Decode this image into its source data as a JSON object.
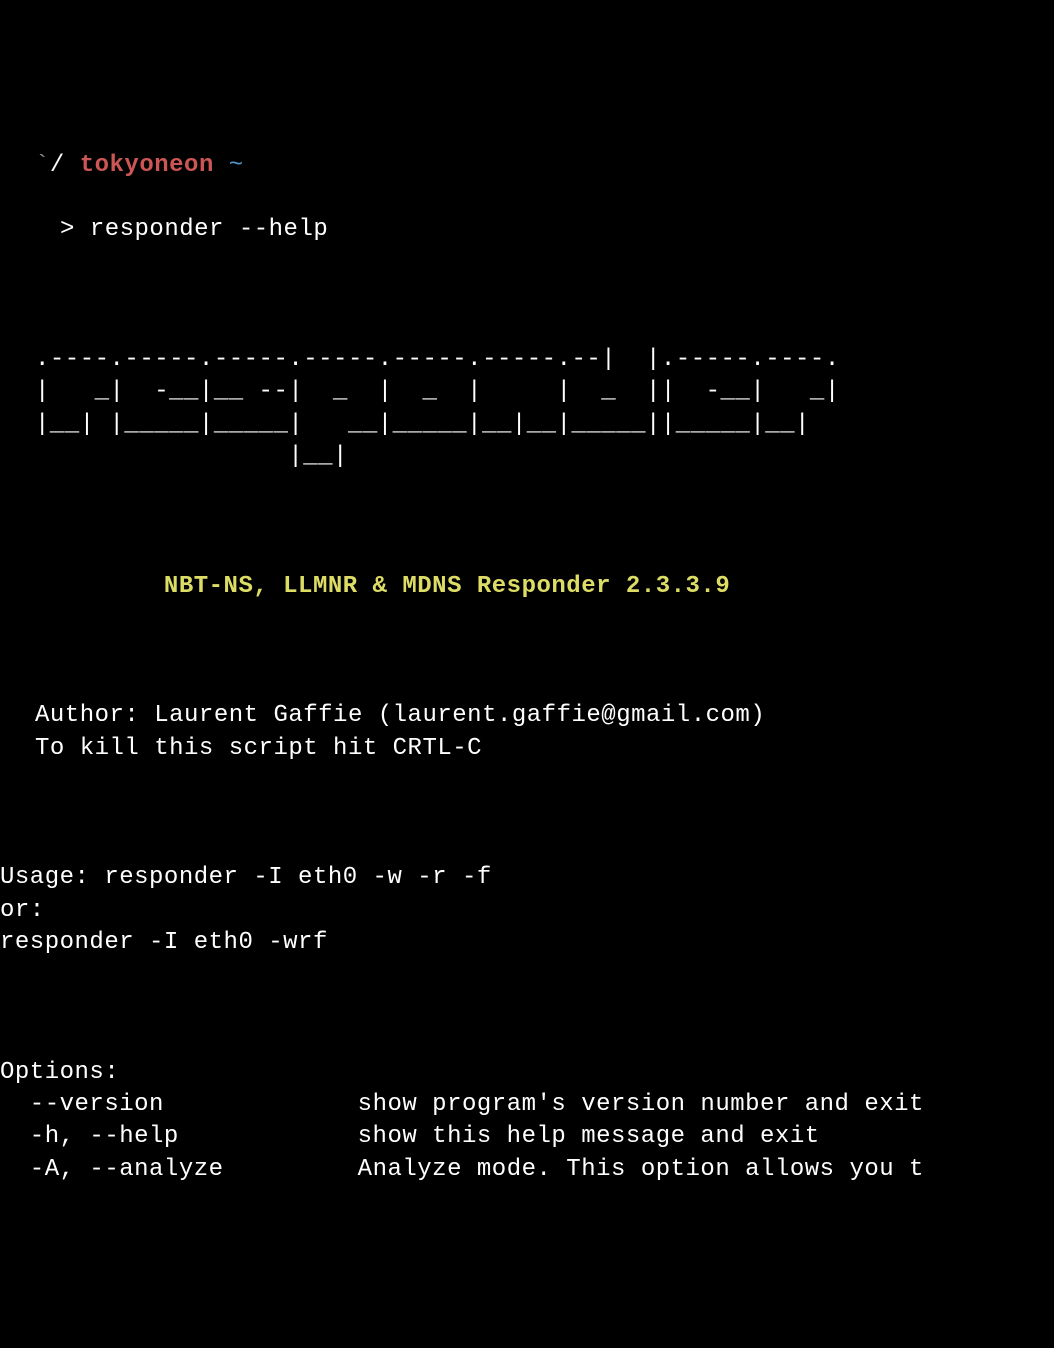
{
  "prompt": {
    "backtick": "`",
    "slash": "/",
    "user": "tokyoneon",
    "tilde": "~",
    "arrow": ">",
    "command": "responder --help"
  },
  "ascii_art": {
    "line1": ".----.-----.-----.-----.-----.-----.--|  |.-----.----.",
    "line2": "|   _|  -__|__ --|  _  |  _  |     |  _  ||  -__|   _|",
    "line3": "|__| |_____|_____|   __|_____|__|__|_____||_____|__|",
    "line4": "                 |__|"
  },
  "title": "           NBT-NS, LLMNR & MDNS Responder 2.3.3.9",
  "author": {
    "line1": "Author: Laurent Gaffie (laurent.gaffie@gmail.com)",
    "line2": "To kill this script hit CRTL-C"
  },
  "usage": {
    "line1": "Usage: responder -I eth0 -w -r -f",
    "line2": "or:",
    "line3": "responder -I eth0 -wrf"
  },
  "options": {
    "header": "Options:",
    "items": [
      {
        "flag": "  --version",
        "spacing": "             ",
        "description": "show program's version number and exit"
      },
      {
        "flag": "  -h, --help",
        "spacing": "            ",
        "description": "show this help message and exit"
      },
      {
        "flag": "  -A, --analyze",
        "spacing": "         ",
        "description": "Analyze mode. This option allows you t"
      }
    ]
  }
}
